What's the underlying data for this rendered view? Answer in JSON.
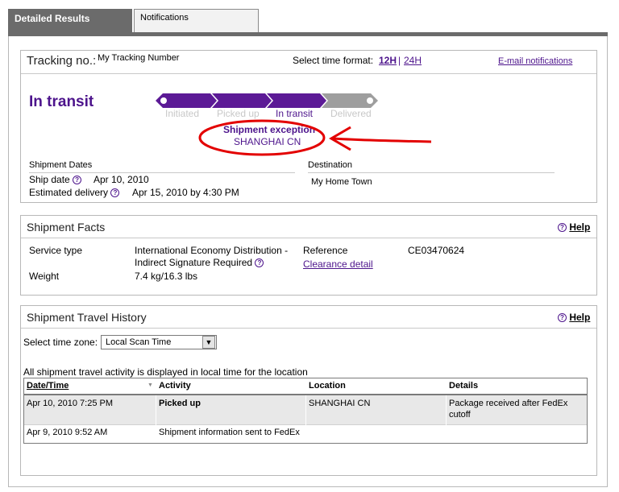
{
  "tabs": {
    "detailed": "Detailed Results",
    "notifications": "Notifications"
  },
  "tracking": {
    "label": "Tracking no.:",
    "number": "My Tracking Number",
    "time_format_label": "Select time format:",
    "format_12h": "12H",
    "separator": "|",
    "format_24h": "24H",
    "email_link": "E-mail notifications",
    "status": "In transit",
    "progress_steps": [
      "Initiated",
      "Picked up",
      "In transit",
      "Delivered"
    ],
    "exception_title": "Shipment exception",
    "exception_location": "SHANGHAI CN",
    "dates_heading": "Shipment Dates",
    "ship_date_label": "Ship date",
    "ship_date": "Apr 10, 2010",
    "est_delivery_label": "Estimated delivery",
    "est_delivery": "Apr 15, 2010 by 4:30 PM",
    "destination_heading": "Destination",
    "destination": "My Home Town",
    "help_glyph": "?"
  },
  "facts": {
    "title": "Shipment Facts",
    "help": "Help",
    "service_label": "Service type",
    "service_line1": "International Economy Distribution -",
    "service_line2": "Indirect Signature Required",
    "weight_label": "Weight",
    "weight": "7.4 kg/16.3 lbs",
    "reference_label": "Reference",
    "reference": "CE03470624",
    "clearance": "Clearance detail"
  },
  "history": {
    "title": "Shipment Travel History",
    "help": "Help",
    "tz_label": "Select time zone:",
    "tz_value": "Local Scan Time",
    "tz_arrow": "▼",
    "note": "All shipment travel activity is displayed in local time for the location",
    "columns": [
      "Date/Time",
      "Activity",
      "Location",
      "Details"
    ],
    "sort_glyph": "▼",
    "rows": [
      {
        "date": "Apr 10, 2010 7:25 PM",
        "activity": "Picked up",
        "location": "SHANGHAI CN",
        "details1": "Package received after FedEx",
        "details2": "cutoff"
      },
      {
        "date": "Apr 9, 2010 9:52 AM",
        "activity": "Shipment information sent to FedEx",
        "location": "",
        "details1": "",
        "details2": ""
      }
    ]
  },
  "colors": {
    "brand_purple": "#4d148c",
    "tab_gray": "#6b6b6b",
    "annotation_red": "#e30000"
  }
}
